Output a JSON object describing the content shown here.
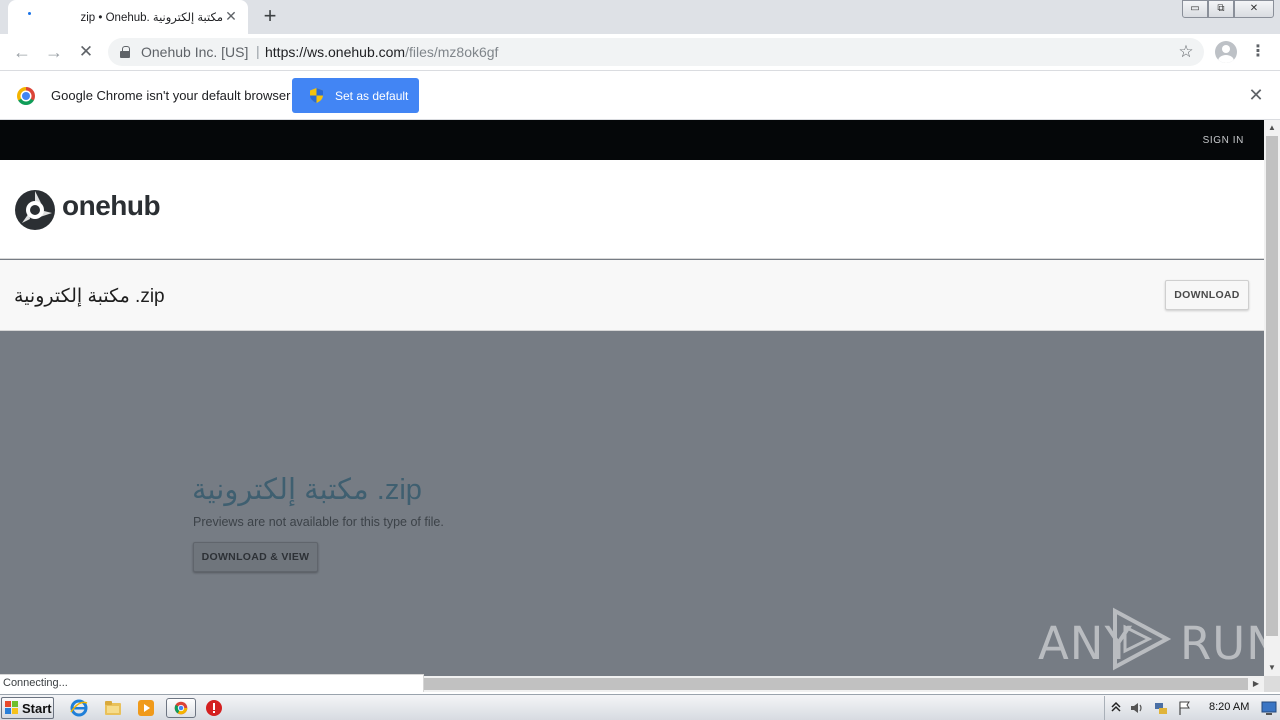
{
  "browser": {
    "tab": {
      "title": "zip • Onehub. مكتبة إلكترونية",
      "close_glyph": "✕"
    },
    "new_tab_glyph": "+",
    "window_controls": {
      "minimize": "▭",
      "maximize": "⧉",
      "close": "✕"
    },
    "omnibox": {
      "origin": "Onehub Inc. [US]",
      "separator": "|",
      "url_host": "https://ws.onehub.com",
      "url_path": "/files/mz8ok6gf"
    },
    "nav": {
      "back": "←",
      "forward": "→",
      "stop": "✕",
      "bookmark": "☆",
      "menu": "⋮"
    },
    "infobar": {
      "message": "Google Chrome isn't your default browser",
      "button_label": "Set as default",
      "close_glyph": "✕"
    },
    "status_text": "Connecting..."
  },
  "site": {
    "signin_label": "SIGN IN",
    "brand_name": "onehub",
    "file_title": "مكتبة إلكترونية .zip",
    "download_label": "DOWNLOAD",
    "preview": {
      "title": "مكتبة إلكترونية .zip",
      "subtitle": "Previews are not available for this type of file.",
      "button_label": "DOWNLOAD & VIEW"
    },
    "watermark": {
      "left": "ANY",
      "right": "RUN"
    }
  },
  "taskbar": {
    "start_label": "Start",
    "clock": "8:20 AM"
  },
  "colors": {
    "accent": "#4285f4",
    "site_header": "#050709",
    "preview_bg": "#767c84",
    "preview_title": "#3f5f70"
  }
}
